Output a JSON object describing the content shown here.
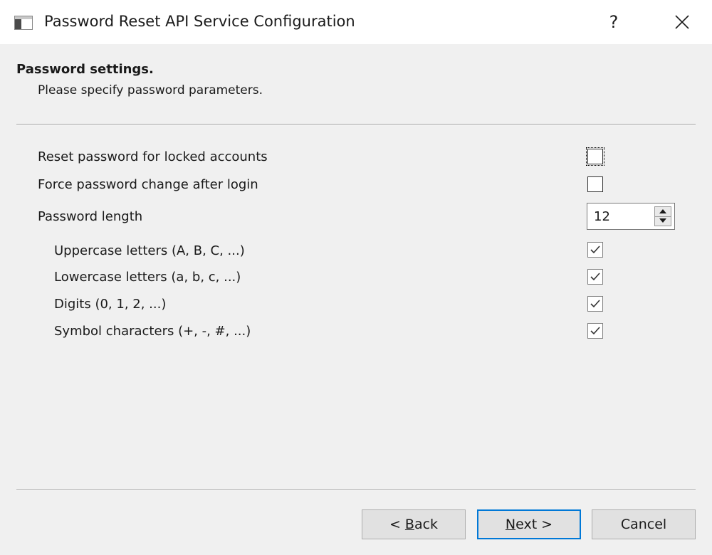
{
  "window": {
    "title": "Password Reset API Service Configuration",
    "help_label": "?",
    "icons": {
      "app": "app-window-icon",
      "close": "close-icon"
    }
  },
  "header": {
    "title": "Password settings.",
    "subtitle": "Please specify password parameters."
  },
  "settings": {
    "reset_locked": {
      "label": "Reset password for locked accounts",
      "checked": false
    },
    "force_change": {
      "label": "Force password change after login",
      "checked": false
    },
    "password_length": {
      "label": "Password length",
      "value": "12"
    },
    "uppercase": {
      "label": "Uppercase letters (A, B, C, ...)",
      "checked": true
    },
    "lowercase": {
      "label": "Lowercase letters (a, b, c, ...)",
      "checked": true
    },
    "digits": {
      "label": "Digits (0, 1, 2, ...)",
      "checked": true
    },
    "symbols": {
      "label": "Symbol characters (+, -, #, ...)",
      "checked": true
    }
  },
  "buttons": {
    "back": {
      "prefix": "< ",
      "accel": "B",
      "rest": "ack"
    },
    "next": {
      "prefix": "",
      "accel": "N",
      "rest": "ext >"
    },
    "cancel": {
      "label": "Cancel"
    }
  },
  "colors": {
    "client_bg": "#f0f0f0",
    "default_button_border": "#0078d7",
    "button_bg": "#e1e1e1"
  }
}
